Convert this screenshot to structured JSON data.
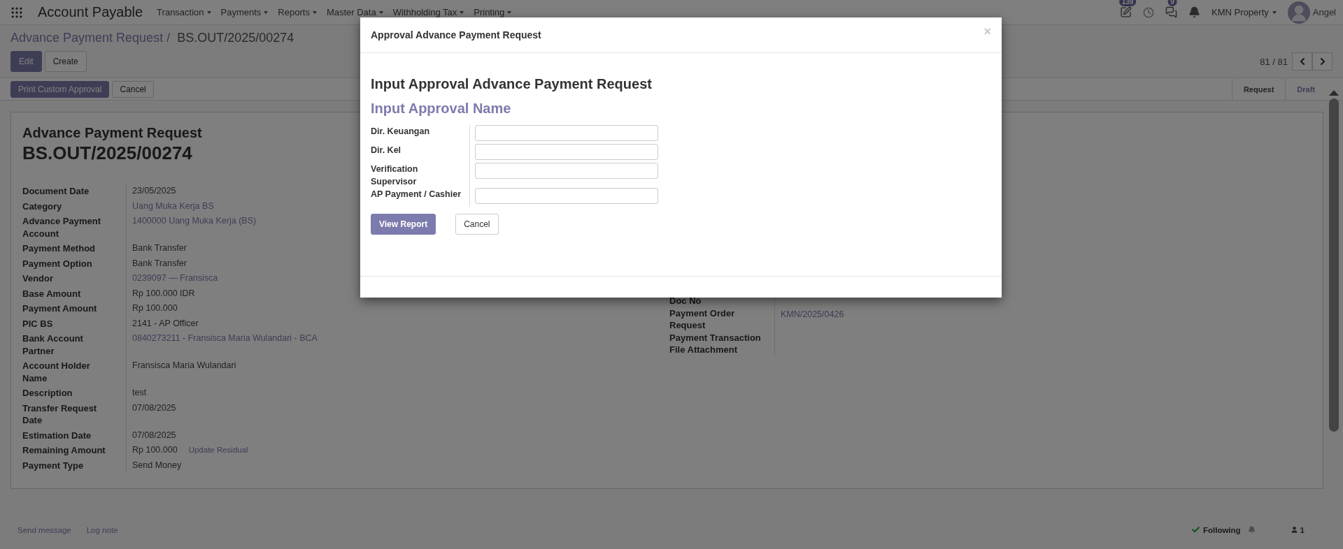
{
  "navbar": {
    "app_title": "Account Payable",
    "menus": [
      "Transaction",
      "Payments",
      "Reports",
      "Master Data",
      "Withholding Tax",
      "Printing"
    ],
    "activity_count": "139",
    "message_count": "9",
    "company": "KMN Property",
    "user": "Angel"
  },
  "breadcrumb": {
    "parent": "Advance Payment Request /",
    "current": "BS.OUT/2025/00274"
  },
  "control_buttons": [
    {
      "label": "Edit",
      "kind": "primary"
    },
    {
      "label": "Create",
      "kind": "default"
    }
  ],
  "pager": {
    "text": "81 / 81"
  },
  "header_buttons": [
    {
      "label": "Print Custom Approval",
      "kind": "primary"
    },
    {
      "label": "Cancel",
      "kind": "default"
    }
  ],
  "stages": [
    {
      "label": "Request",
      "selected": false
    },
    {
      "label": "Draft",
      "selected": true
    }
  ],
  "sheet": {
    "title": "Advance Payment Request",
    "name": "BS.OUT/2025/00274",
    "left_fields": [
      {
        "label": "Document Date",
        "value": "23/05/2025",
        "link": false
      },
      {
        "label": "Category",
        "value": "Uang Muka Kerja BS",
        "link": true
      },
      {
        "label": "Advance Payment Account",
        "value": "1400000 Uang Muka Kerja (BS)",
        "link": true
      },
      {
        "label": "Payment Method",
        "value": "Bank Transfer",
        "link": false
      },
      {
        "label": "Payment Option",
        "value": "Bank Transfer",
        "link": false
      },
      {
        "label": "Vendor",
        "value": "0239097 — Fransisca",
        "link": true
      },
      {
        "label": "Base Amount",
        "value": "Rp 100.000 IDR",
        "link": false
      },
      {
        "label": "Payment Amount",
        "value": "Rp 100.000",
        "link": false
      },
      {
        "label": "PIC BS",
        "value": "2141 - AP Officer",
        "link": false
      },
      {
        "label": "Bank Account Partner",
        "value": "0840273211 - Fransisca Maria Wulandari - BCA",
        "link": true
      },
      {
        "label": "Account Holder Name",
        "value": "Fransisca Maria Wulandari",
        "link": false
      },
      {
        "label": "Description",
        "value": "test",
        "link": false
      },
      {
        "label": "Transfer Request Date",
        "value": "07/08/2025",
        "link": false
      },
      {
        "label": "Estimation Date",
        "value": "07/08/2025",
        "link": false
      },
      {
        "label": "Remaining Amount",
        "value": "Rp 100.000",
        "link": false,
        "action": "Update Residual"
      },
      {
        "label": "Payment Type",
        "value": "Send Money",
        "link": false
      }
    ],
    "right_fields": [
      {
        "label": "Doc No"
      },
      {
        "label": "Payment Order Request",
        "value": "KMN/2025/0426",
        "link": true
      },
      {
        "label": "Payment Transaction"
      },
      {
        "label": "File Attachment"
      }
    ]
  },
  "chatter": {
    "send_message": "Send message",
    "log_note": "Log note",
    "following": "Following",
    "followers": "1"
  },
  "dialog": {
    "title": "Approval Advance Payment Request",
    "close": "×",
    "heading": "Input Approval Advance Payment Request",
    "subheading": "Input Approval Name",
    "fields": [
      {
        "label": "Dir. Keuangan"
      },
      {
        "label": "Dir. Kel"
      },
      {
        "label": "Verification Supervisor"
      },
      {
        "label": "AP Payment / Cashier"
      }
    ],
    "buttons": [
      {
        "label": "View Report",
        "kind": "primary"
      },
      {
        "label": "Cancel",
        "kind": "default"
      }
    ]
  }
}
